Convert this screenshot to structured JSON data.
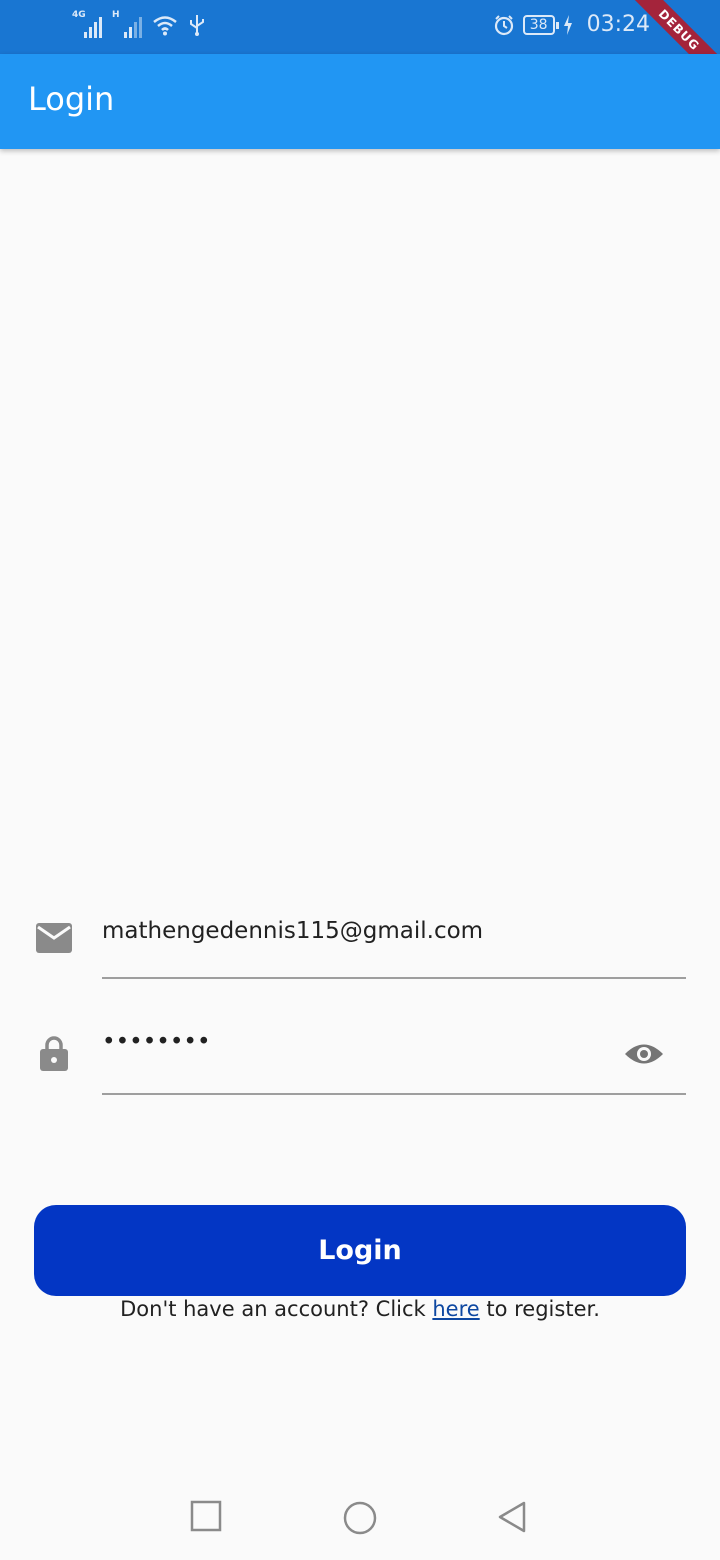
{
  "status_bar": {
    "network_1": "4G",
    "network_2": "H",
    "battery": "38",
    "time": "03:24",
    "debug_label": "DEBUG"
  },
  "app_bar": {
    "title": "Login"
  },
  "form": {
    "email": {
      "value": "mathengedennis115@gmail.com",
      "icon": "mail-icon"
    },
    "password": {
      "value": "••••••••",
      "icon": "lock-icon",
      "toggle_icon": "eye-icon"
    },
    "login_label": "Login",
    "register_prefix": "Don't have an account? Click ",
    "register_link": "here",
    "register_suffix": " to register."
  },
  "colors": {
    "status_bar": "#1976D2",
    "app_bar": "#2196F3",
    "button": "#0336C4",
    "debug_banner": "#A4243B"
  }
}
